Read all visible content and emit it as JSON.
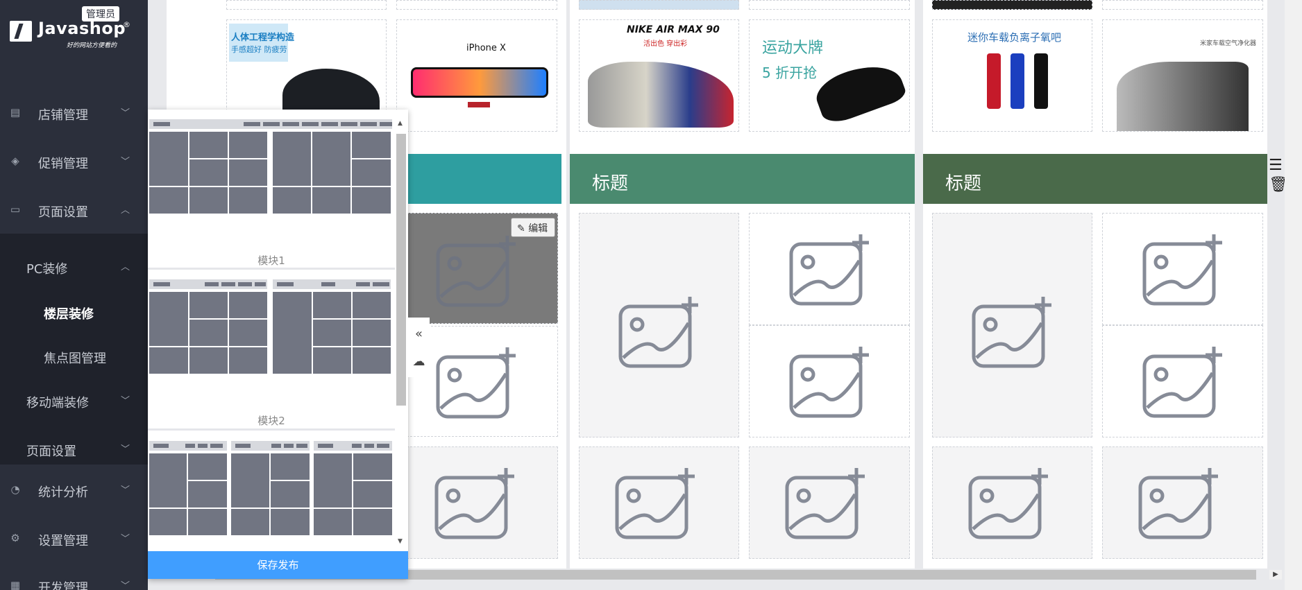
{
  "sidebar": {
    "badge": "管理员",
    "brand": "Javashop",
    "reg": "®",
    "slogan": "好的网站方便看的",
    "items": [
      {
        "label": "店铺管理",
        "icon": "store-icon",
        "chev": "﹀"
      },
      {
        "label": "促销管理",
        "icon": "tag-icon",
        "chev": "﹀"
      },
      {
        "label": "页面设置",
        "icon": "page-icon",
        "chev": "︿"
      },
      {
        "label": "统计分析",
        "icon": "pie-icon",
        "chev": "﹀"
      },
      {
        "label": "设置管理",
        "icon": "gear-icon",
        "chev": "﹀"
      },
      {
        "label": "开发管理",
        "icon": "dev-icon",
        "chev": "﹀"
      }
    ],
    "sub": {
      "pc": {
        "label": "PC装修",
        "chev": "︿"
      },
      "floor": "楼层装修",
      "focus": "焦点图管理",
      "mobile": {
        "label": "移动端装修",
        "chev": "﹀"
      },
      "pageset": {
        "label": "页面设置",
        "chev": "﹀"
      }
    }
  },
  "main": {
    "titles": [
      "标题",
      "标题"
    ],
    "edit_label": "编辑",
    "products": {
      "mouse_title": "人体工程学构造",
      "mouse_sub": "手感超好 防疲劳",
      "iphone": "iPhone X",
      "nike_brand": "NIKE AIR MAX 90",
      "nike_sub": "活出色 穿出彩",
      "sport_title": "运动大牌",
      "sport_sub": "5 折开抢",
      "car_title": "迷你车载负离子氧吧",
      "purifier": "米家车载空气净化器"
    },
    "accent_colors": [
      "#2e9ea0",
      "#4a8a6f",
      "#4a6a4a"
    ]
  },
  "panel": {
    "templates": [
      "模块1",
      "模块2"
    ],
    "save_label": "保存发布",
    "collapse_icon": "double-chevron-left-icon",
    "upload_icon": "cloud-upload-icon"
  }
}
